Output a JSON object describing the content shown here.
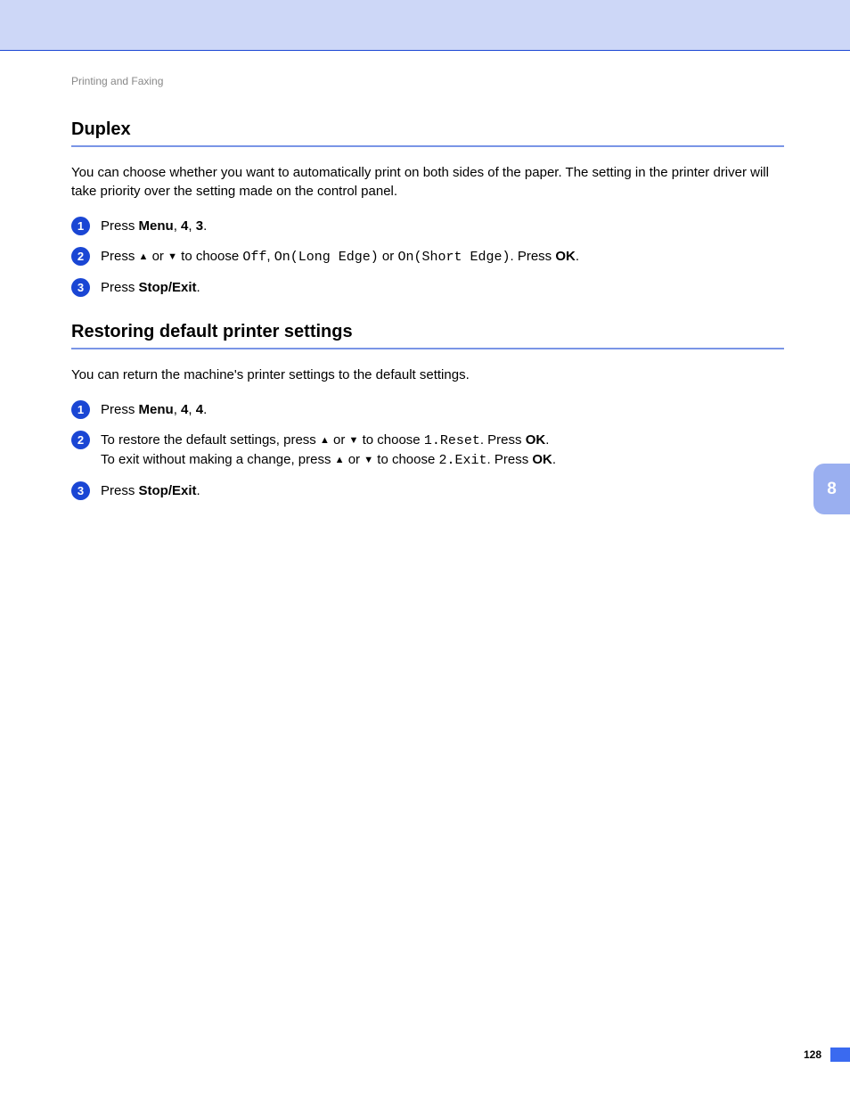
{
  "header": "Printing and Faxing",
  "chapter_tab": "8",
  "page_number": "128",
  "sections": [
    {
      "title": "Duplex",
      "intro": "You can choose whether you want to automatically print on both sides of the paper. The setting in the printer driver will take priority over the setting made on the control panel.",
      "steps": [
        {
          "num": "1",
          "segments": [
            {
              "t": "Press "
            },
            {
              "t": "Menu",
              "b": true
            },
            {
              "t": ", "
            },
            {
              "t": "4",
              "b": true
            },
            {
              "t": ", "
            },
            {
              "t": "3",
              "b": true
            },
            {
              "t": "."
            }
          ]
        },
        {
          "num": "2",
          "segments": [
            {
              "t": "Press "
            },
            {
              "t": "▲",
              "arrow": true
            },
            {
              "t": " or "
            },
            {
              "t": "▼",
              "arrow": true
            },
            {
              "t": " to choose "
            },
            {
              "t": "Off",
              "mono": true
            },
            {
              "t": ", "
            },
            {
              "t": "On(Long Edge)",
              "mono": true
            },
            {
              "t": " or "
            },
            {
              "t": "On(Short Edge)",
              "mono": true
            },
            {
              "t": ". Press "
            },
            {
              "t": "OK",
              "b": true
            },
            {
              "t": "."
            }
          ]
        },
        {
          "num": "3",
          "segments": [
            {
              "t": "Press "
            },
            {
              "t": "Stop/Exit",
              "b": true
            },
            {
              "t": "."
            }
          ]
        }
      ]
    },
    {
      "title": "Restoring default printer settings",
      "intro": "You can return the machine's printer settings to the default settings.",
      "steps": [
        {
          "num": "1",
          "segments": [
            {
              "t": "Press "
            },
            {
              "t": "Menu",
              "b": true
            },
            {
              "t": ", "
            },
            {
              "t": "4",
              "b": true
            },
            {
              "t": ", "
            },
            {
              "t": "4",
              "b": true
            },
            {
              "t": "."
            }
          ]
        },
        {
          "num": "2",
          "lines": [
            [
              {
                "t": "To restore the default settings, press "
              },
              {
                "t": "▲",
                "arrow": true
              },
              {
                "t": " or "
              },
              {
                "t": "▼",
                "arrow": true
              },
              {
                "t": " to choose "
              },
              {
                "t": "1.Reset",
                "mono": true
              },
              {
                "t": ". Press "
              },
              {
                "t": "OK",
                "b": true
              },
              {
                "t": "."
              }
            ],
            [
              {
                "t": "To exit without making a change, press "
              },
              {
                "t": "▲",
                "arrow": true
              },
              {
                "t": " or "
              },
              {
                "t": "▼",
                "arrow": true
              },
              {
                "t": " to choose "
              },
              {
                "t": "2.Exit",
                "mono": true
              },
              {
                "t": ". Press "
              },
              {
                "t": "OK",
                "b": true
              },
              {
                "t": "."
              }
            ]
          ]
        },
        {
          "num": "3",
          "segments": [
            {
              "t": "Press "
            },
            {
              "t": "Stop/Exit",
              "b": true
            },
            {
              "t": "."
            }
          ]
        }
      ]
    }
  ]
}
